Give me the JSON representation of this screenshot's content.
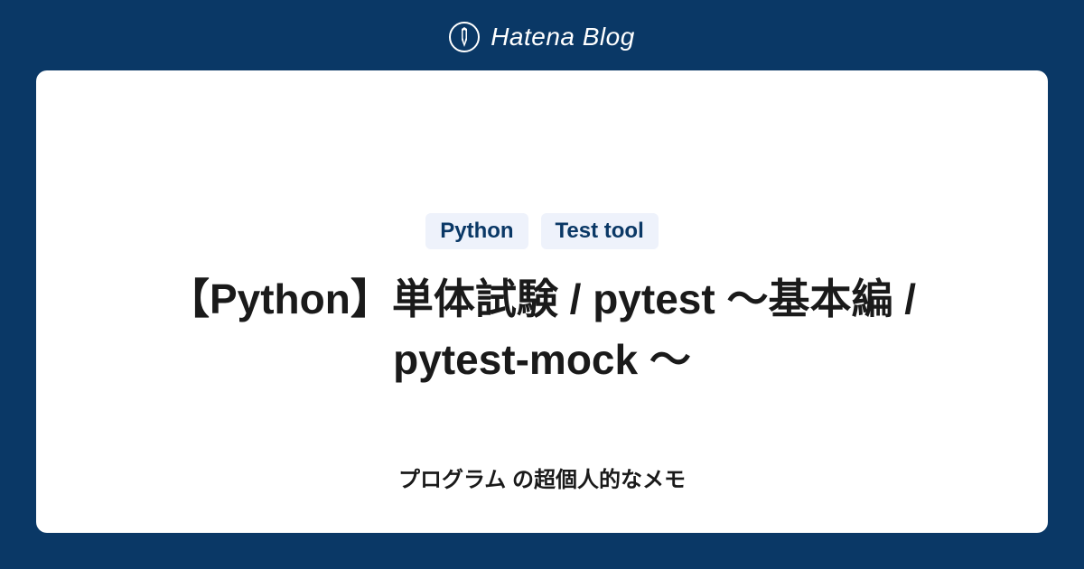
{
  "header": {
    "brand_name": "Hatena Blog"
  },
  "card": {
    "tags": [
      "Python",
      "Test tool"
    ],
    "title": "【Python】単体試験 / pytest ～基本編 / pytest-mock ～",
    "subtitle": "プログラム の超個人的なメモ"
  },
  "colors": {
    "background": "#0a3866",
    "card_bg": "#ffffff",
    "tag_bg": "#eef2fb",
    "tag_text": "#0a3866"
  }
}
